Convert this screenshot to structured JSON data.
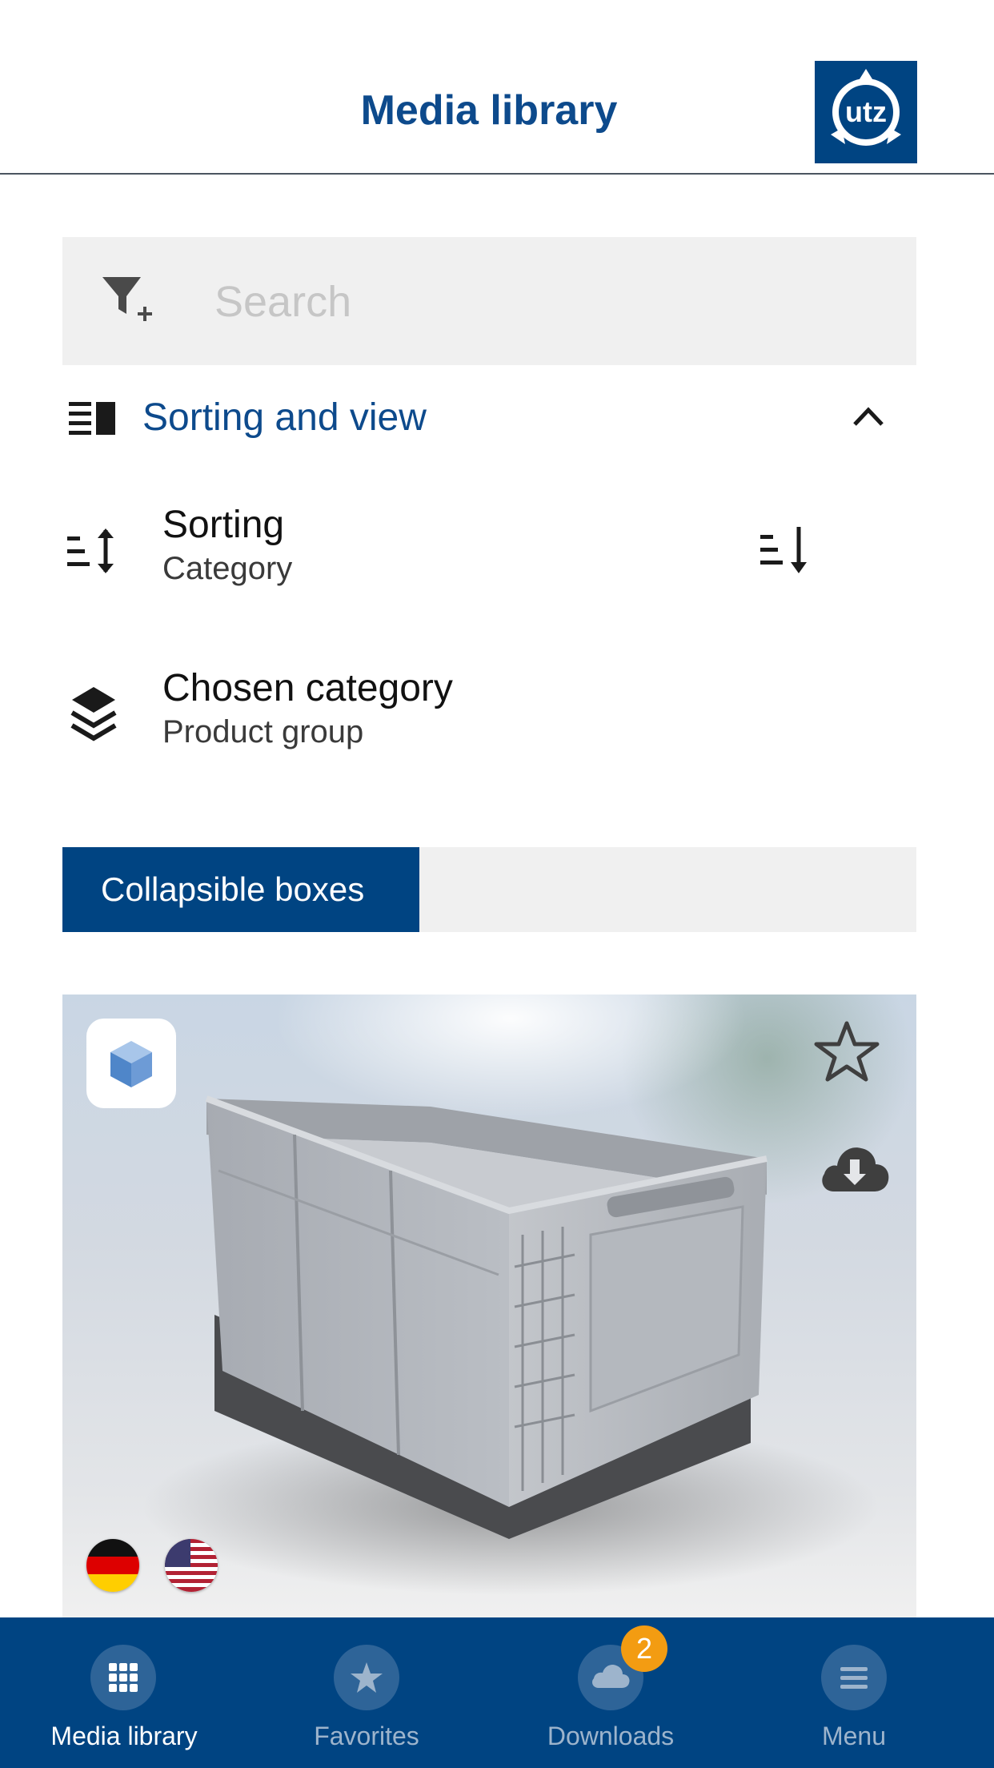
{
  "header": {
    "title": "Media library",
    "logo_text": "utz"
  },
  "search": {
    "placeholder": "Search",
    "value": ""
  },
  "sorting_view": {
    "label": "Sorting and view",
    "expanded": true
  },
  "sorting": {
    "title": "Sorting",
    "value": "Category"
  },
  "chosen_category": {
    "title": "Chosen category",
    "value": "Product group"
  },
  "category_tabs": [
    {
      "label": "Collapsible boxes",
      "selected": true
    }
  ],
  "card": {
    "favorite": false,
    "languages": [
      "German",
      "English (US)"
    ]
  },
  "tabs": [
    {
      "label": "Media library",
      "icon": "grid-icon",
      "active": true
    },
    {
      "label": "Favorites",
      "icon": "star-icon",
      "active": false
    },
    {
      "label": "Downloads",
      "icon": "cloud-icon",
      "active": false,
      "badge": "2"
    },
    {
      "label": "Menu",
      "icon": "menu-icon",
      "active": false
    }
  ],
  "colors": {
    "brand": "#004482",
    "title": "#0d4a8c",
    "badge": "#f39c12",
    "surface": "#f0f0f0"
  }
}
